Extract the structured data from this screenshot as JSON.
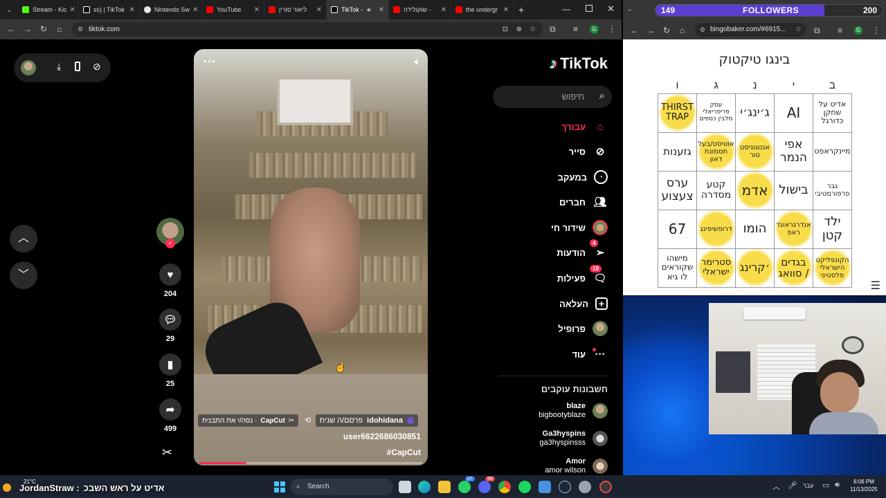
{
  "tabs": [
    {
      "label": "Stream - Kic",
      "color": "#53fc18"
    },
    {
      "label": "ss) | TikTok",
      "color": "#ffffff"
    },
    {
      "label": "Nintendo Sw",
      "color": "#e60012"
    },
    {
      "label": "YouTube",
      "color": "#ff0000"
    },
    {
      "label": "ליאור סורין",
      "color": "#ff0000"
    },
    {
      "label": "TikTok -",
      "color": "#ffffff"
    },
    {
      "label": "שוקולידה -",
      "color": "#ff0000"
    },
    {
      "label": "the undergr",
      "color": "#ff0000"
    }
  ],
  "address": {
    "url": "tiktok.com"
  },
  "tiktok": {
    "logo": "TikTok",
    "search_placeholder": "חיפוש",
    "nav": [
      {
        "label": "עבורך",
        "icon": "home-icon",
        "active": true
      },
      {
        "label": "סייר",
        "icon": "compass-icon"
      },
      {
        "label": "במעקב",
        "icon": "following-icon"
      },
      {
        "label": "חברים",
        "icon": "friends-icon"
      },
      {
        "label": "שידור חי",
        "icon": "live-icon"
      },
      {
        "label": "הודעות",
        "icon": "send-icon",
        "badge": "4"
      },
      {
        "label": "פעילות",
        "icon": "inbox-icon",
        "badge": "19"
      },
      {
        "label": "העלאה",
        "icon": "upload-icon"
      },
      {
        "label": "פרופיל",
        "icon": "profile-icon"
      },
      {
        "label": "עוד",
        "icon": "more-icon"
      }
    ],
    "following_header": "חשבונות עוקבים",
    "following": [
      {
        "name": "blaze",
        "handle": "bigbootyblaze"
      },
      {
        "name": "Ga3hyspins",
        "handle": "ga3hyspinsss"
      },
      {
        "name": "Amor",
        "handle": "amor wilson"
      }
    ],
    "actions": {
      "likes": "204",
      "comments": "29",
      "saves": "25",
      "shares": "499"
    },
    "video": {
      "stitch_user": "idohidana",
      "stitch_text": "פרסם/ה שנית",
      "capcut_label": "CapCut",
      "capcut_text": "נסה/י את התבנית ·",
      "author": "user6622686030851",
      "hashtag": "#CapCut",
      "progress": 0.21
    }
  },
  "stream_overlay": {
    "followers_label": "FOLLOWERS",
    "followers_current": "149",
    "followers_goal": "200",
    "ticker_name": "JordanStraw :",
    "ticker_text": "אדיט על ראש השבכ",
    "temp": "21°C"
  },
  "bingo": {
    "url": "bingobaker.com/#6915...",
    "title": "בינגו טיקטוק",
    "headers": [
      "ו",
      "ג",
      "נ",
      "י",
      "ב"
    ],
    "rows": [
      [
        {
          "t": "THIRST TRAP",
          "hl": true,
          "s": 13
        },
        {
          "t": "עסק פריפריאלי מלבין כספים",
          "hl": false,
          "s": 9
        },
        {
          "t": "ג׳ינג׳י",
          "hl": false,
          "s": 17
        },
        {
          "t": "AI",
          "hl": false,
          "s": 20
        },
        {
          "t": "אדיט על שחקן כדורגל",
          "hl": false,
          "s": 11
        }
      ],
      [
        {
          "t": "גזענות",
          "hl": false,
          "s": 15
        },
        {
          "t": "אוטיסט/בעל תסמונת דאון",
          "hl": true,
          "s": 10
        },
        {
          "t": "אנטגוניסט טור",
          "hl": true,
          "s": 10
        },
        {
          "t": "אפי הנמר",
          "hl": false,
          "s": 17
        },
        {
          "t": "מיינקראפט",
          "hl": false,
          "s": 11
        }
      ],
      [
        {
          "t": "ערס צעצוע",
          "hl": false,
          "s": 17
        },
        {
          "t": "קטע מסדרה",
          "hl": false,
          "s": 14
        },
        {
          "t": "אדמ",
          "hl": true,
          "s": 20
        },
        {
          "t": "בישול",
          "hl": false,
          "s": 18
        },
        {
          "t": "גבר פרפורמטיבי",
          "hl": false,
          "s": 10
        }
      ],
      [
        {
          "t": "67",
          "hl": false,
          "s": 20
        },
        {
          "t": "דרופשיפינג",
          "hl": true,
          "s": 10
        },
        {
          "t": "הומו",
          "hl": false,
          "s": 18
        },
        {
          "t": "אנדרגראונד ראפ",
          "hl": true,
          "s": 10
        },
        {
          "t": "ילד קטן",
          "hl": false,
          "s": 18
        }
      ],
      [
        {
          "t": "מישהו שקוראים לו גיא",
          "hl": false,
          "s": 12
        },
        {
          "t": "סטרימר ישראלי",
          "hl": true,
          "s": 13
        },
        {
          "t": "׳קרינג",
          "hl": true,
          "s": 16
        },
        {
          "t": "בגדים סוואג /",
          "hl": true,
          "s": 15
        },
        {
          "t": "הקונפליקט הישראלי פלסטיני",
          "hl": true,
          "s": 10
        }
      ]
    ]
  },
  "taskbar": {
    "search": "Search",
    "lang": "עבר",
    "time": "6:06 PM",
    "date": "11/13/2025",
    "whatsapp_badge": "27",
    "discord_badge": "99"
  },
  "colors": {
    "accent": "#fe2c55",
    "bingo_highlight": "#f8dc4a",
    "followers_bar": "#5b3fd0"
  }
}
